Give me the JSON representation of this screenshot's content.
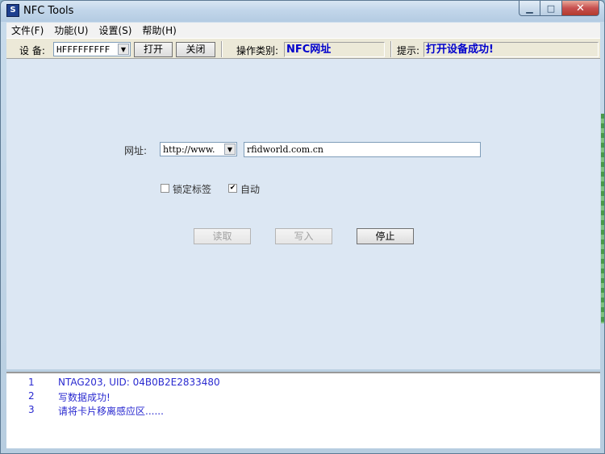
{
  "window": {
    "title": "NFC Tools",
    "app_icon": "NFC-app-icon",
    "close_glyph": "✕"
  },
  "menu": [
    "文件(F)",
    "功能(U)",
    "设置(S)",
    "帮助(H)"
  ],
  "toolbar": {
    "device_label": "设  备:",
    "device_value": "HFFFFFFFFF",
    "open_label": "打开",
    "close_label": "关闭",
    "operation_label": "操作类别:",
    "operation_value": "NFC网址",
    "hint_label": "提示:",
    "hint_value": "打开设备成功!"
  },
  "form": {
    "url_label": "网址:",
    "url_prefix": "http://www.",
    "url_value": "rfidworld.com.cn",
    "lock_tag_label": "锁定标签",
    "lock_tag_checked": false,
    "auto_label": "自动",
    "auto_checked": true,
    "read_label": "读取",
    "write_label": "写入",
    "stop_label": "停止"
  },
  "log": [
    {
      "num": "1",
      "text": "NTAG203, UID: 04B0B2E2833480"
    },
    {
      "num": "2",
      "text": "写数据成功!"
    },
    {
      "num": "3",
      "text": "请将卡片移离感应区......"
    }
  ],
  "colors": {
    "accent_text": "#0000cc",
    "log_text": "#2a2ad0",
    "main_bg": "#dce7f3"
  }
}
